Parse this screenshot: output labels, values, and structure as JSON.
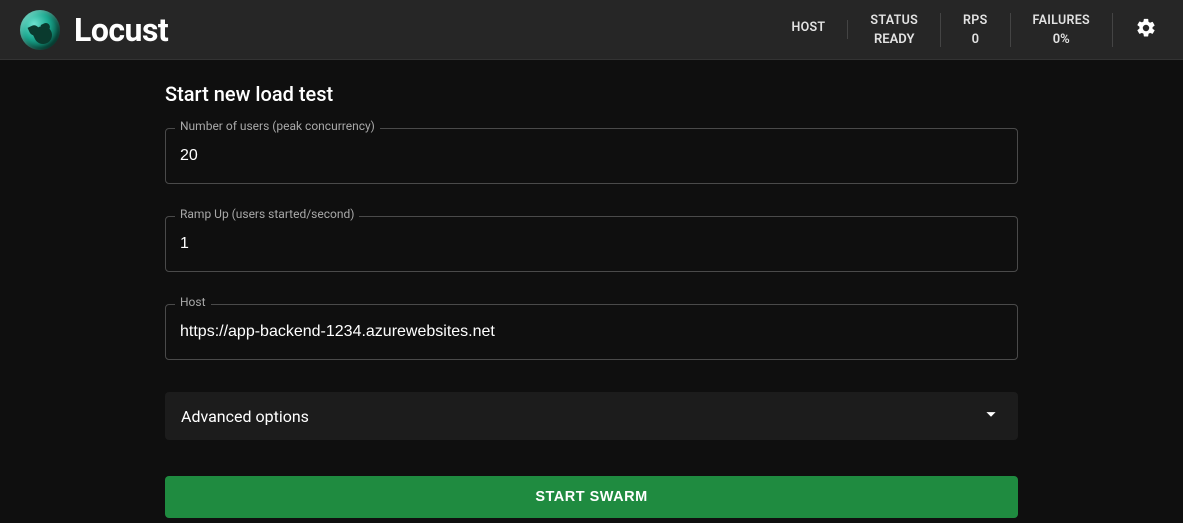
{
  "brand": {
    "name": "Locust"
  },
  "stats": {
    "host": {
      "label": "HOST",
      "value": ""
    },
    "status": {
      "label": "STATUS",
      "value": "READY"
    },
    "rps": {
      "label": "RPS",
      "value": "0"
    },
    "failures": {
      "label": "FAILURES",
      "value": "0%"
    }
  },
  "page": {
    "title": "Start new load test",
    "fields": {
      "users": {
        "label": "Number of users (peak concurrency)",
        "value": "20"
      },
      "ramp": {
        "label": "Ramp Up (users started/second)",
        "value": "1"
      },
      "host": {
        "label": "Host",
        "value": "https://app-backend-1234.azurewebsites.net"
      }
    },
    "advanced_label": "Advanced options",
    "start_label": "START SWARM"
  }
}
